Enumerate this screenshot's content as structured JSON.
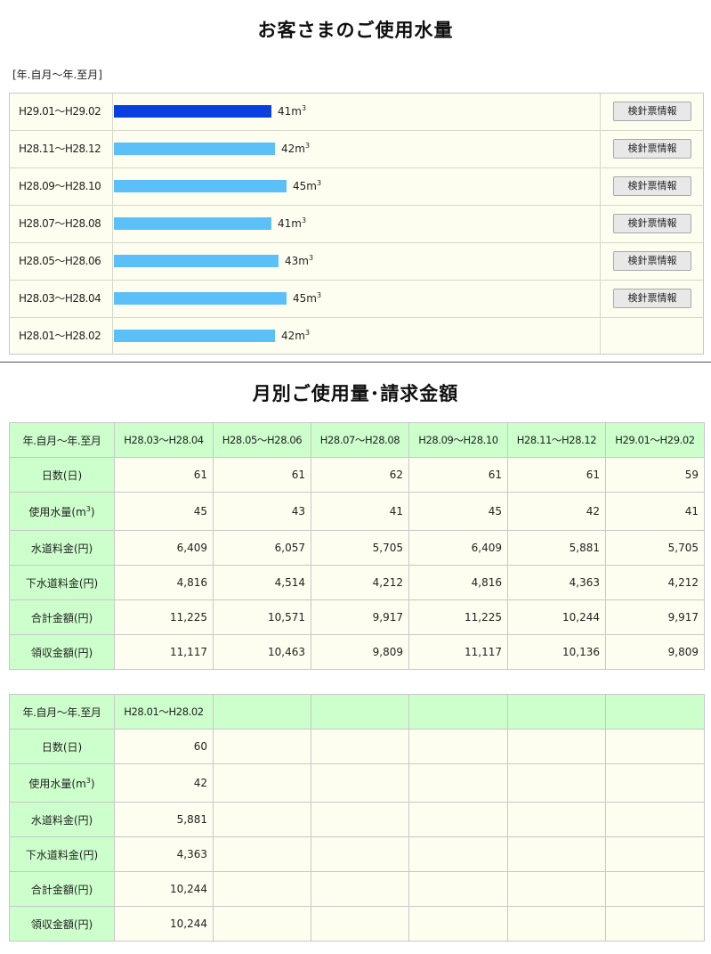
{
  "usage": {
    "title": "お客さまのご使用水量",
    "range_label": "[年.自月～年.至月]",
    "button_label": "検針票情報",
    "unit_text": "m",
    "unit_exp": "3",
    "max_value": 45,
    "rows": [
      {
        "period": "H29.01～H29.02",
        "amount": "41",
        "value": 41,
        "current": true,
        "has_button": true
      },
      {
        "period": "H28.11～H28.12",
        "amount": "42",
        "value": 42,
        "current": false,
        "has_button": true
      },
      {
        "period": "H28.09～H28.10",
        "amount": "45",
        "value": 45,
        "current": false,
        "has_button": true
      },
      {
        "period": "H28.07～H28.08",
        "amount": "41",
        "value": 41,
        "current": false,
        "has_button": true
      },
      {
        "period": "H28.05～H28.06",
        "amount": "43",
        "value": 43,
        "current": false,
        "has_button": true
      },
      {
        "period": "H28.03～H28.04",
        "amount": "45",
        "value": 45,
        "current": false,
        "has_button": true
      },
      {
        "period": "H28.01～H28.02",
        "amount": "42",
        "value": 42,
        "current": false,
        "has_button": false
      }
    ]
  },
  "monthly": {
    "title": "月別ご使用量･請求金額",
    "header_label": "年.自月～年.至月",
    "row_labels": {
      "days": "日数(日)",
      "usage_prefix": "使用水量(m",
      "usage_exp": "3",
      "usage_suffix": ")",
      "water_fee": "水道料金(円)",
      "sewer_fee": "下水道料金(円)",
      "total": "合計金額(円)",
      "received": "領収金額(円)"
    },
    "table1": {
      "periods": [
        "H28.03～H28.04",
        "H28.05～H28.06",
        "H28.07～H28.08",
        "H28.09～H28.10",
        "H28.11～H28.12",
        "H29.01～H29.02"
      ],
      "days": [
        "61",
        "61",
        "62",
        "61",
        "61",
        "59"
      ],
      "usage": [
        "45",
        "43",
        "41",
        "45",
        "42",
        "41"
      ],
      "water_fee": [
        "6,409",
        "6,057",
        "5,705",
        "6,409",
        "5,881",
        "5,705"
      ],
      "sewer_fee": [
        "4,816",
        "4,514",
        "4,212",
        "4,816",
        "4,363",
        "4,212"
      ],
      "total": [
        "11,225",
        "10,571",
        "9,917",
        "11,225",
        "10,244",
        "9,917"
      ],
      "received": [
        "11,117",
        "10,463",
        "9,809",
        "11,117",
        "10,136",
        "9,809"
      ]
    },
    "table2": {
      "periods": [
        "H28.01～H28.02",
        "",
        "",
        "",
        "",
        ""
      ],
      "days": [
        "60",
        "",
        "",
        "",
        "",
        ""
      ],
      "usage": [
        "42",
        "",
        "",
        "",
        "",
        ""
      ],
      "water_fee": [
        "5,881",
        "",
        "",
        "",
        "",
        ""
      ],
      "sewer_fee": [
        "4,363",
        "",
        "",
        "",
        "",
        ""
      ],
      "total": [
        "10,244",
        "",
        "",
        "",
        "",
        ""
      ],
      "received": [
        "10,244",
        "",
        "",
        "",
        "",
        ""
      ]
    }
  }
}
